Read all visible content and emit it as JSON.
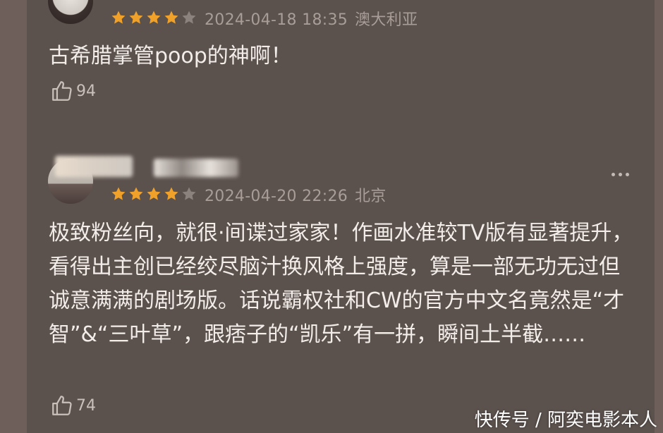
{
  "comments": [
    {
      "date": "2024-04-18 18:35",
      "location": "澳大利亚",
      "rating": 4,
      "text": "古希腊掌管poop的神啊！",
      "likes": "94"
    },
    {
      "date": "2024-04-20 22:26",
      "location": "北京",
      "rating": 4,
      "text": "极致粉丝向，就很·间谍过家家！作画水准较TV版有显著提升，看得出主创已经绞尽脑汁换风格上强度，算是一部无功无过但诚意满满的剧场版。话说霸权社和CW的官方中文名竟然是“才智”&“三叶草”，跟痞子的“凯乐”有一拼，瞬间土半截……",
      "likes": "74"
    }
  ],
  "watermark": "快传号 / 阿奕电影本人",
  "colors": {
    "star_filled": "#f0a12a",
    "star_empty": "#8c827d",
    "text": "#f2ede9",
    "meta": "#a89d97"
  },
  "icons": {
    "like": "thumbs-up-icon",
    "more": "more-dots-icon",
    "star": "star-icon"
  }
}
